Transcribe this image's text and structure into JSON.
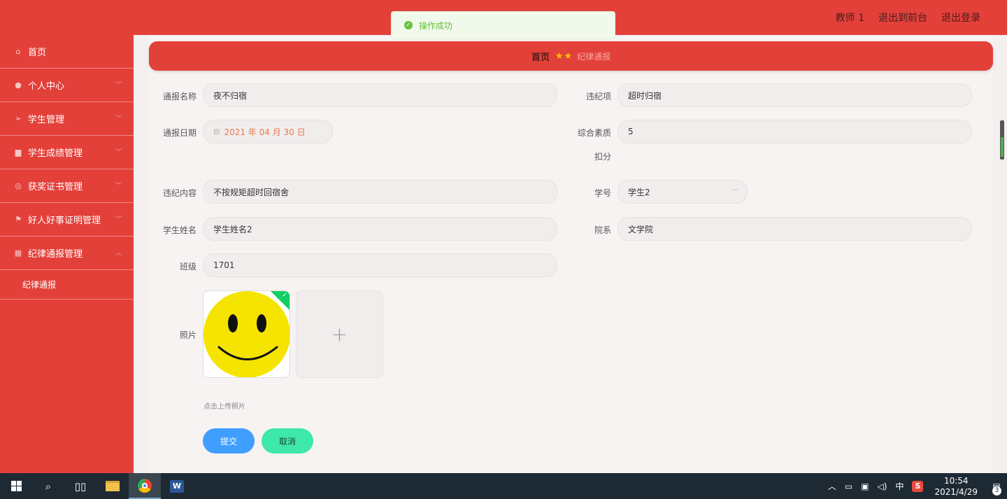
{
  "header": {
    "links": [
      "教师 1",
      "退出到前台",
      "退出登录"
    ]
  },
  "toast": {
    "message": "操作成功"
  },
  "sidebar": {
    "items": [
      {
        "label": "首页",
        "icon": "home-icon",
        "expandable": false
      },
      {
        "label": "个人中心",
        "icon": "user-icon",
        "expandable": true
      },
      {
        "label": "学生管理",
        "icon": "send-icon",
        "expandable": true
      },
      {
        "label": "学生成绩管理",
        "icon": "thumb-icon",
        "expandable": true
      },
      {
        "label": "获奖证书管理",
        "icon": "globe-icon",
        "expandable": true
      },
      {
        "label": "好人好事证明管理",
        "icon": "flag-icon",
        "expandable": true
      },
      {
        "label": "纪律通报管理",
        "icon": "grid-icon",
        "expandable": true,
        "expanded": true
      }
    ],
    "subitems": [
      "纪律通报"
    ]
  },
  "breadcrumb": {
    "home": "首页",
    "current": "纪律通报"
  },
  "form": {
    "report_name": {
      "label": "通报名称",
      "value": "夜不归宿"
    },
    "violation_item": {
      "label": "违纪项",
      "value": "超时归宿"
    },
    "report_date": {
      "label": "通报日期",
      "value": "2021 年 04 月 30 日"
    },
    "quality_deduction": {
      "label_line1": "综合素质",
      "label_line2": "扣分",
      "value": "5"
    },
    "violation_content": {
      "label": "违纪内容",
      "value": "不按规矩超时回宿舍"
    },
    "student_id": {
      "label": "学号",
      "value": "学生2"
    },
    "student_name": {
      "label": "学生姓名",
      "value": "学生姓名2"
    },
    "department": {
      "label": "院系",
      "value": "文学院"
    },
    "class": {
      "label": "班级",
      "value": "1701"
    },
    "photo": {
      "label": "照片",
      "hint": "点击上传照片"
    },
    "submit_label": "提交",
    "cancel_label": "取消"
  },
  "taskbar": {
    "tray_lang": "中",
    "time": "10:54",
    "date": "2021/4/29",
    "notification_count": "3"
  },
  "colors": {
    "primary": "#e4403a",
    "success": "#67c23a",
    "submit": "#409eff",
    "cancel": "#3de8a9"
  }
}
